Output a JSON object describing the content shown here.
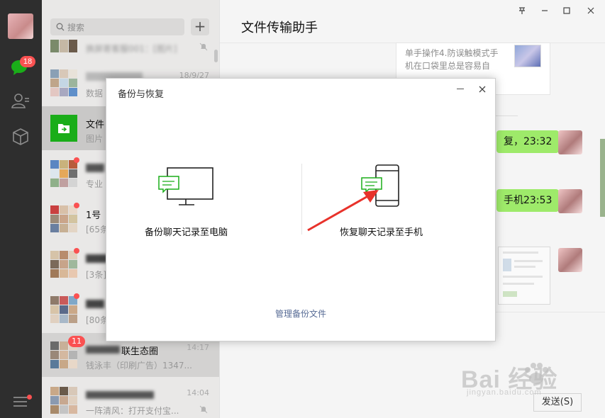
{
  "nav": {
    "badge": "18",
    "icons": [
      "avatar",
      "chat-icon",
      "contacts-icon",
      "favorites-cube-icon",
      "menu-icon"
    ],
    "accent": "#1aad19"
  },
  "search": {
    "placeholder": "搜索",
    "add": "+"
  },
  "chats": [
    {
      "name": "",
      "msg": "换屏寄客服001：[图片]",
      "time": "",
      "muted": true
    },
    {
      "name": "",
      "msg": "数据",
      "time": "18/9/27"
    },
    {
      "name": "文件",
      "msg": "图片",
      "time": ""
    },
    {
      "name": "",
      "msg": "专业",
      "time": ""
    },
    {
      "name": "1号",
      "msg": "[65条",
      "time": ""
    },
    {
      "name": "",
      "msg": "[3条]",
      "time": ""
    },
    {
      "name": "",
      "msg": "[80条",
      "time": ""
    },
    {
      "name": "联生态圈",
      "msg": "钱泳丰（印刷广告）1347...",
      "time": "14:17",
      "badge": "11"
    },
    {
      "name": "",
      "msg": "一阵清风：打开支付宝...",
      "time": "14:04",
      "muted": true
    }
  ],
  "panel": {
    "title": "文件传输助手",
    "window_controls": [
      "pin",
      "minimize",
      "maximize",
      "close"
    ],
    "card_text": "单手操作4.防误触模式手机在口袋里总是容易自",
    "bubble1": "复，23:32",
    "bubble2": "手机23:53",
    "send": "发送(S)"
  },
  "dialog": {
    "title": "备份与恢复",
    "option_left": "备份聊天记录至电脑",
    "option_right": "恢复聊天记录至手机",
    "manage": "管理备份文件"
  },
  "watermark": {
    "main": "Bai 经验",
    "sub": "jingyan.baidu.com"
  },
  "colors": {
    "bubble": "#9eea6a",
    "badge": "#fa5151",
    "link": "#576b95",
    "arrow": "#e8322b",
    "icon_green": "#1aad19"
  }
}
